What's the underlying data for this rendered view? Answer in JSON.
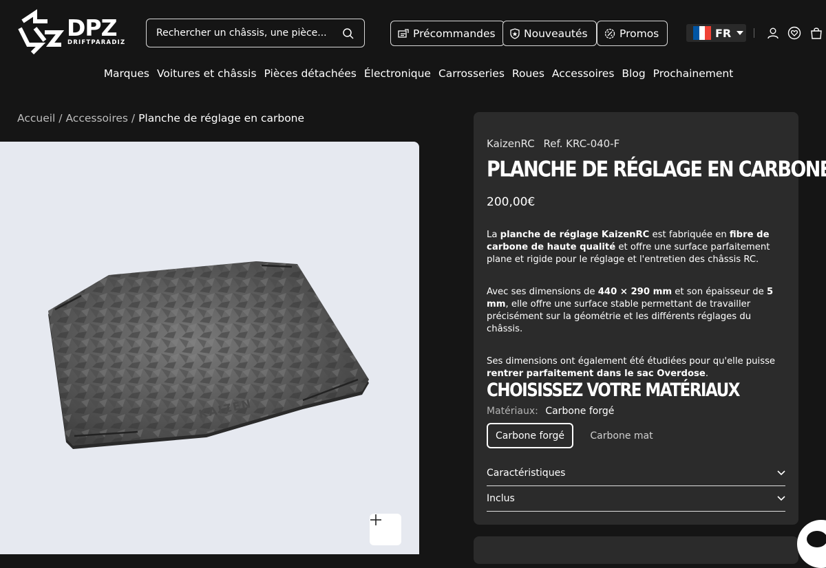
{
  "brand": {
    "name": "DPZ",
    "subtitle": "DRIFTPARADIZ"
  },
  "search": {
    "placeholder": "Rechercher un châssis, une pièce..."
  },
  "header_buttons": [
    "Précommandes",
    "Nouveautés",
    "Promos"
  ],
  "language": {
    "code": "FR"
  },
  "nav": [
    "Marques",
    "Voitures et châssis",
    "Pièces détachées",
    "Électronique",
    "Carrosseries",
    "Roues",
    "Accessoires",
    "Blog",
    "Prochainement"
  ],
  "breadcrumb": {
    "home": "Accueil",
    "category": "Accessoires",
    "current": "Planche de réglage en carbone",
    "separator": "/"
  },
  "product": {
    "vendor": "KaizenRC",
    "ref": "Ref. KRC-040-F",
    "title": "PLANCHE DE RÉGLAGE EN CARBONE",
    "price": "200,00€",
    "image_logo_text": "KAIZEN",
    "description": {
      "p1": [
        "La ",
        "planche de réglage KaizenRC",
        " est fabriquée en ",
        "fibre de carbone de haute qualité",
        " et offre une surface parfaitement plane et rigide pour le réglage et l'entretien des châssis RC."
      ],
      "p2": [
        "Avec ses dimensions de ",
        "440 × 290 mm",
        " et son épaisseur de ",
        "5 mm",
        ", elle offre une surface stable permettant de travailler précisément sur la géométrie et les différents réglages du châssis."
      ],
      "p3": [
        "Ses dimensions ont également été étudiées pour qu'elle puisse ",
        "rentrer parfaitement dans le sac Overdose",
        "."
      ]
    },
    "choose_title": "CHOISISSEZ VOTRE MATÉRIAUX",
    "material_label": "Matériaux:",
    "material_selected": "Carbone forgé",
    "options": [
      "Carbone forgé",
      "Carbone mat"
    ],
    "accordions": [
      "Caractéristiques",
      "Inclus"
    ]
  },
  "colors": {
    "bg": "#151515",
    "panel": "#2b2b2b",
    "media_bg": "#e6e9f0",
    "flag_blue": "#0055a4",
    "flag_red": "#ef4135"
  }
}
